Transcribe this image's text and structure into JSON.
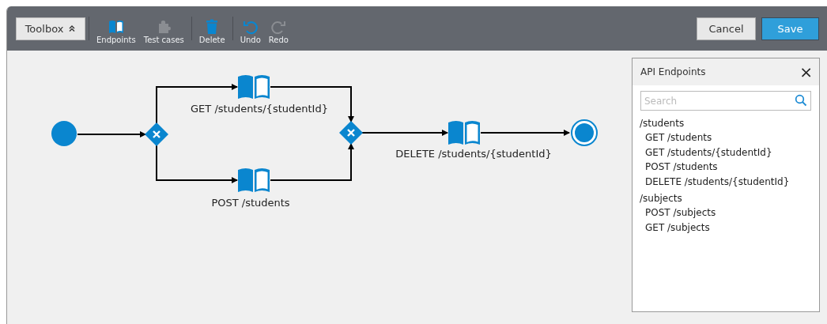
{
  "toolbar": {
    "toolbox": {
      "label": "Toolbox",
      "expanded": true
    },
    "tool_groups": [
      [
        {
          "label": "Endpoints",
          "kind": "book",
          "disabled": false
        },
        {
          "label": "Test cases",
          "kind": "puzzle",
          "disabled": true
        }
      ],
      [
        {
          "label": "Delete",
          "kind": "trash",
          "disabled": false
        }
      ],
      [
        {
          "label": "Undo",
          "kind": "undo",
          "disabled": false
        },
        {
          "label": "Redo",
          "kind": "redo",
          "disabled": true
        }
      ]
    ],
    "buttons": [
      {
        "label": "Cancel",
        "kind": "secondary"
      },
      {
        "label": "Save",
        "kind": "primary"
      }
    ]
  },
  "diagram": {
    "tasks": [
      {
        "label": "GET /students/{studentId}"
      },
      {
        "label": "POST /students"
      },
      {
        "label": "DELETE /students/{studentId}"
      }
    ]
  },
  "panel": {
    "title": "API Endpoints",
    "close": "×",
    "search": {
      "placeholder": "Search"
    },
    "groups": [
      {
        "name": "/students",
        "endpoints": [
          "GET /students",
          "GET /students/{studentId}",
          "POST /students",
          "DELETE /students/{studentId}"
        ]
      },
      {
        "name": "/subjects",
        "endpoints": [
          "POST /subjects",
          "GET /subjects"
        ]
      }
    ]
  }
}
